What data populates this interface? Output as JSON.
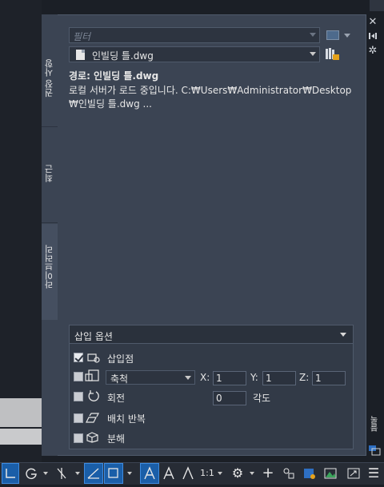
{
  "palette": {
    "tabs": [
      "권장 사항",
      "최근",
      "라이브러리"
    ],
    "filter_placeholder": "필터",
    "file_dropdown_value": "인빌딩 틀.dwg",
    "path_label": "경로: 인빌딩 틀.dwg",
    "loading_line1": "로컬 서버가 로드 중입니다. C:₩Users₩Administrator₩Desktop",
    "loading_line2": "₩인빌딩 틀.dwg ..."
  },
  "insert_options": {
    "title": "삽입 옵션",
    "insertion_point": {
      "label": "삽입점",
      "checked": true
    },
    "scale": {
      "checked": false,
      "dropdown": "축척",
      "x_label": "X:",
      "x_value": "1",
      "y_label": "Y:",
      "y_value": "1",
      "z_label": "Z:",
      "z_value": "1"
    },
    "rotation": {
      "label": "회전",
      "checked": false,
      "angle_value": "0",
      "angle_label": "각도"
    },
    "repeat_placement": {
      "label": "배치 반복",
      "checked": false
    },
    "explode": {
      "label": "분해",
      "checked": false
    }
  },
  "side_rail": {
    "close_icon": "close-icon",
    "autohide_icon": "autohide-icon",
    "settings_icon": "settings-icon",
    "vertical_title": "블록"
  },
  "status_bar": {
    "scale": "1:1"
  },
  "colors": {
    "panel_bg": "#3b4453",
    "selected_blue": "#1a5ea8"
  }
}
